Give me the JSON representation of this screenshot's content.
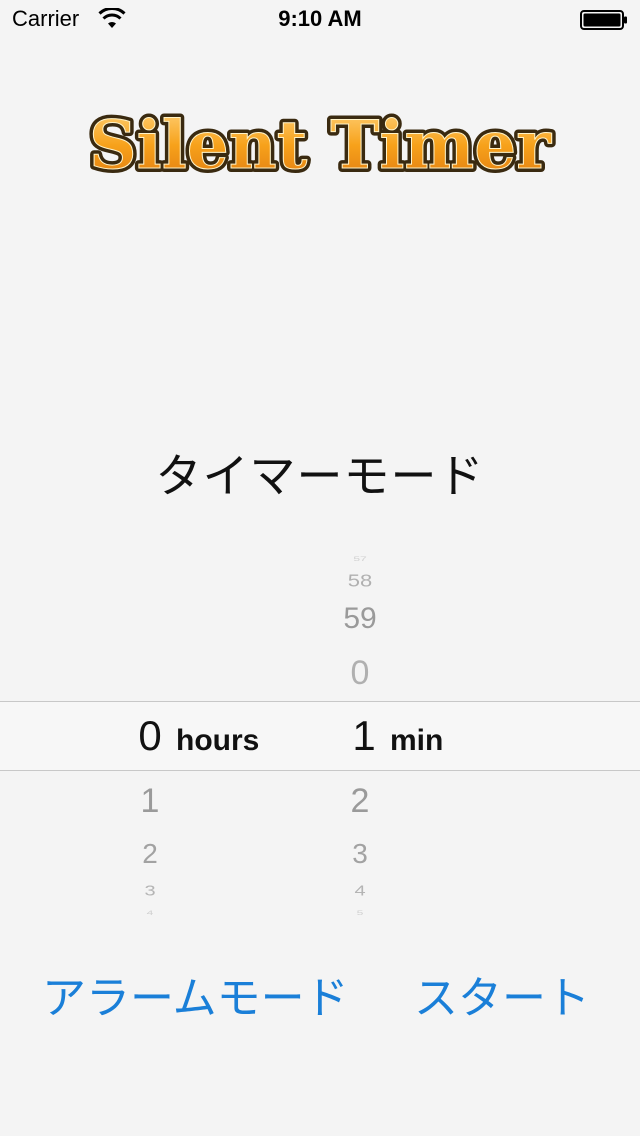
{
  "status_bar": {
    "carrier": "Carrier",
    "time": "9:10 AM",
    "icons": [
      "wifi-icon",
      "battery-icon"
    ]
  },
  "logo": {
    "text": "Silent Timer",
    "fill_color": "#f7a21b",
    "outline_color": "#3a2a10"
  },
  "mode_title": "タイマーモード",
  "picker": {
    "hours": {
      "selected": "0",
      "above": [],
      "below": [
        "1",
        "2",
        "3",
        "4"
      ],
      "unit": "hours"
    },
    "minutes": {
      "selected": "1",
      "above": [
        "57",
        "58",
        "59",
        "0"
      ],
      "below": [
        "2",
        "3",
        "4",
        "5"
      ],
      "unit": "min"
    }
  },
  "buttons": {
    "alarm_mode": "アラームモード",
    "start": "スタート"
  },
  "colors": {
    "accent": "#1a7fd8",
    "background": "#f4f4f4",
    "selection_border": "#c8c8c8"
  }
}
